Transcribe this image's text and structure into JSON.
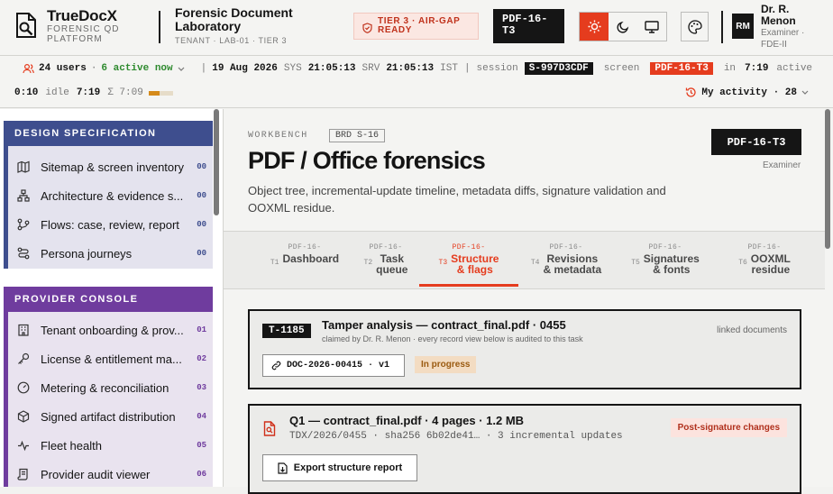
{
  "brand": {
    "name": "TrueDocX",
    "sub1": "FORENSIC QD",
    "sub2": "PLATFORM"
  },
  "lab": {
    "title1": "Forensic Document",
    "title2": "Laboratory",
    "sub": "TENANT · LAB-01 · TIER 3"
  },
  "tier": {
    "line1": "TIER 3 · AIR-GAP",
    "line2": "READY"
  },
  "screen_chip": {
    "line1": "PDF-16-",
    "line2": "T3"
  },
  "user": {
    "initials": "RM",
    "name1": "Dr. R.",
    "name2": "Menon",
    "role1": "Examiner ·",
    "role2": "FDE-II"
  },
  "status": {
    "users": "24 users",
    "sep1": "·",
    "active": "6 active now",
    "date": "19 Aug 2026",
    "sys_label": "SYS",
    "sys_time": "21:05:13",
    "srv_label": "SRV",
    "srv_time": "21:05:13",
    "tz": "IST",
    "session_label": "session",
    "session_id": "S-997D3CDF",
    "screen_label": "screen",
    "screen_id": "PDF-16-T3",
    "in_label": "in",
    "in_time": "7:19",
    "active_label": "active",
    "active_time": "0:10",
    "idle_label": "idle",
    "idle_time": "7:19",
    "sum_label": "Σ 7:09",
    "progress": 0.45,
    "activity_label": "My activity · 28"
  },
  "sidebar": {
    "design": {
      "title": "DESIGN SPECIFICATION",
      "color": "#3e4e8e",
      "items": [
        {
          "label": "Sitemap & screen inventory",
          "num": "00",
          "icon": "map-icon"
        },
        {
          "label": "Architecture & evidence s...",
          "num": "00",
          "icon": "sitemap-icon"
        },
        {
          "label": "Flows: case, review, report",
          "num": "00",
          "icon": "flow-icon"
        },
        {
          "label": "Persona journeys",
          "num": "00",
          "icon": "route-icon"
        }
      ]
    },
    "provider": {
      "title": "PROVIDER CONSOLE",
      "color": "#6f3c9e",
      "items": [
        {
          "label": "Tenant onboarding & prov...",
          "num": "01",
          "icon": "building-icon"
        },
        {
          "label": "License & entitlement ma...",
          "num": "02",
          "icon": "key-icon"
        },
        {
          "label": "Metering & reconciliation",
          "num": "03",
          "icon": "gauge-icon"
        },
        {
          "label": "Signed artifact distribution",
          "num": "04",
          "icon": "package-icon"
        },
        {
          "label": "Fleet health",
          "num": "05",
          "icon": "pulse-icon"
        },
        {
          "label": "Provider audit viewer",
          "num": "06",
          "icon": "scroll-icon"
        }
      ]
    }
  },
  "main": {
    "workbench": "WORKBENCH",
    "brd": "BRD S-16",
    "screen_tag": "PDF-16-T3",
    "role": "Examiner",
    "title": "PDF / Office forensics",
    "description": "Object tree, incremental-update timeline, metadata diffs, signature validation and OOXML residue.",
    "tabs": [
      {
        "code": "PDF-16-",
        "num": "T1",
        "l1": "Dashboard",
        "l2": ""
      },
      {
        "code": "PDF-16-",
        "num": "T2",
        "l1": "Task",
        "l2": "queue"
      },
      {
        "code": "PDF-16-",
        "num": "T3",
        "l1": "Structure",
        "l2": "& flags"
      },
      {
        "code": "PDF-16-",
        "num": "T4",
        "l1": "Revisions",
        "l2": "& metadata"
      },
      {
        "code": "PDF-16-",
        "num": "T5",
        "l1": "Signatures",
        "l2": "& fonts"
      },
      {
        "code": "PDF-16-",
        "num": "T6",
        "l1": "OOXML",
        "l2": "residue"
      }
    ],
    "task": {
      "id": "T-1185",
      "title": "Tamper analysis — contract_final.pdf · 0455",
      "claimed": "claimed by Dr. R. Menon · every record view below is audited to this task",
      "linked": "linked documents",
      "doc": "DOC-2026-00415 · v1",
      "status": "In progress"
    },
    "q1": {
      "title": "Q1 — contract_final.pdf · 4 pages · 1.2 MB",
      "meta": "TDX/2026/0455 · sha256 6b02de41… · 3 incremental updates",
      "badge": "Post-signature changes",
      "export": "Export structure report"
    }
  }
}
